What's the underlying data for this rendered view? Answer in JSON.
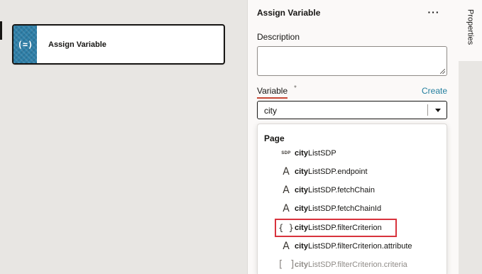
{
  "canvas": {
    "node": {
      "icon": "assign-variable-icon",
      "icon_glyph": "(=)",
      "label": "Assign Variable"
    }
  },
  "panel": {
    "title": "Assign Variable",
    "more_glyph": "···",
    "description": {
      "label": "Description",
      "value": ""
    },
    "variable": {
      "label": "Variable",
      "required_mark": "*",
      "create_link": "Create",
      "value": "city"
    }
  },
  "dropdown": {
    "group_label": "Page",
    "options": [
      {
        "icon": "sdp-icon",
        "glyph": "SDP",
        "match": "city",
        "rest": "ListSDP"
      },
      {
        "icon": "string-type-icon",
        "glyph": "A",
        "match": "city",
        "rest": "ListSDP.endpoint"
      },
      {
        "icon": "string-type-icon",
        "glyph": "A",
        "match": "city",
        "rest": "ListSDP.fetchChain"
      },
      {
        "icon": "string-type-icon",
        "glyph": "A",
        "match": "city",
        "rest": "ListSDP.fetchChainId"
      },
      {
        "icon": "object-type-icon",
        "glyph": "{ }",
        "match": "city",
        "rest": "ListSDP.filterCriterion"
      },
      {
        "icon": "string-type-icon",
        "glyph": "A",
        "match": "city",
        "rest": "ListSDP.filterCriterion.attribute"
      },
      {
        "icon": "array-type-icon",
        "glyph": "[ ]",
        "match": "city",
        "rest": "ListSDP.filterCriterion.criteria"
      }
    ],
    "highlighted_index": 4
  },
  "rail": {
    "tab_properties": "Properties"
  },
  "colors": {
    "accent_link": "#227e9e",
    "required_underline": "#c74634",
    "highlight_box": "#d8333d",
    "node_icon_bg": "#2e7fa8"
  }
}
